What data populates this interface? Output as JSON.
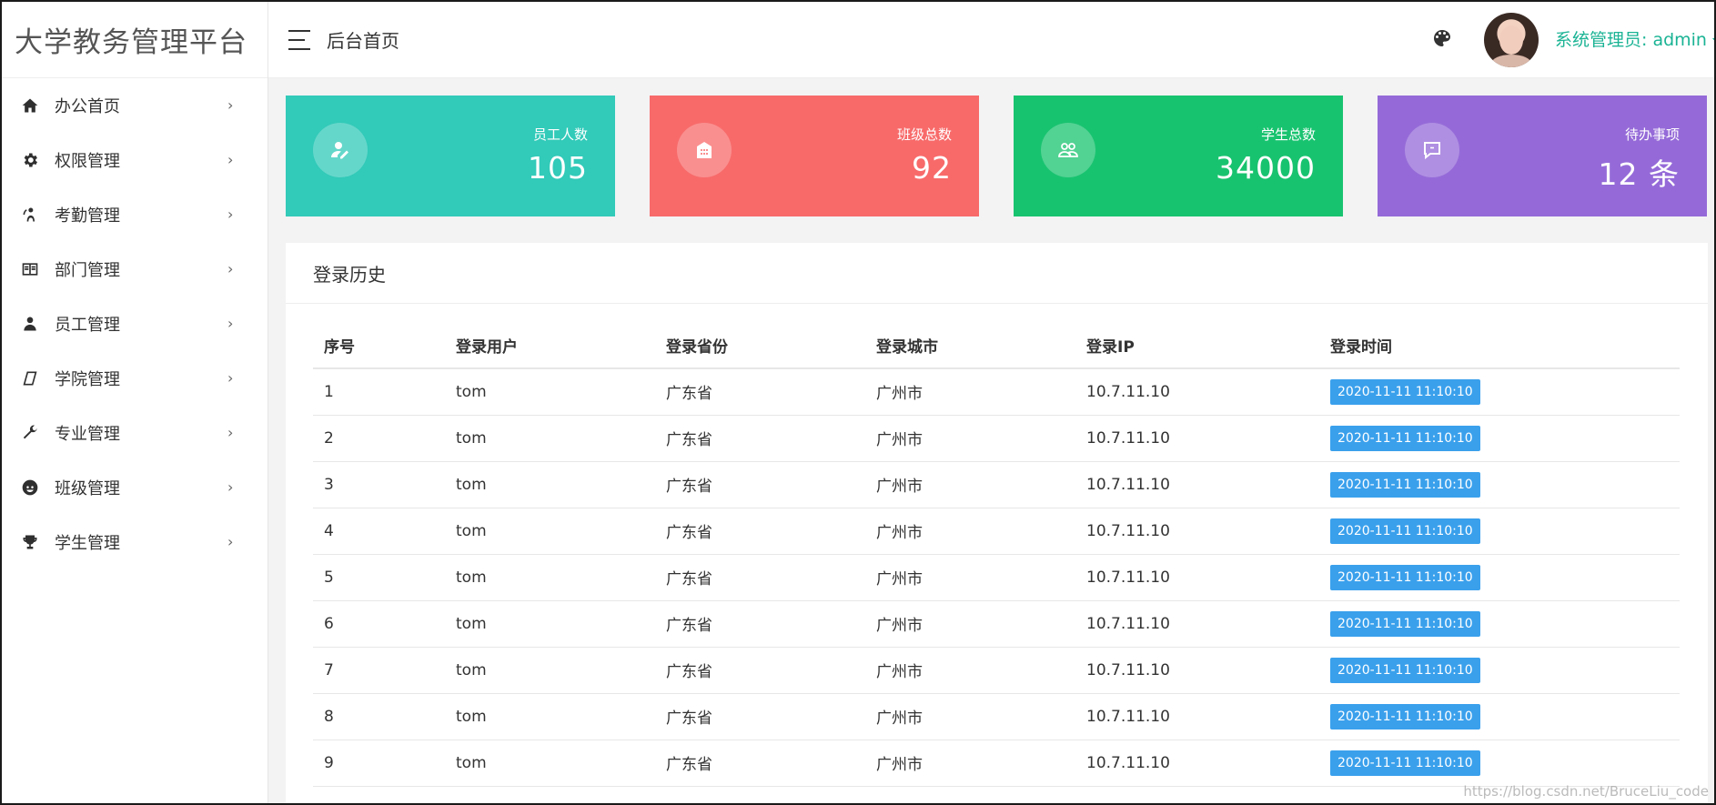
{
  "app": {
    "brand": "大学教务管理平台"
  },
  "header": {
    "title": "后台首页",
    "user_label": "系统管理员: admin"
  },
  "sidebar": {
    "items": [
      {
        "label": "办公首页",
        "icon": "home-icon"
      },
      {
        "label": "权限管理",
        "icon": "gear-icon"
      },
      {
        "label": "考勤管理",
        "icon": "attendance-icon"
      },
      {
        "label": "部门管理",
        "icon": "department-icon"
      },
      {
        "label": "员工管理",
        "icon": "user-icon"
      },
      {
        "label": "学院管理",
        "icon": "college-icon"
      },
      {
        "label": "专业管理",
        "icon": "wrench-icon"
      },
      {
        "label": "班级管理",
        "icon": "face-icon"
      },
      {
        "label": "学生管理",
        "icon": "trophy-icon"
      }
    ],
    "arrow": "›"
  },
  "cards": [
    {
      "label": "员工人数",
      "value": "105",
      "color": "#32cab9",
      "icon": "edit-user-icon"
    },
    {
      "label": "班级总数",
      "value": "92",
      "color": "#f86a6a",
      "icon": "building-icon"
    },
    {
      "label": "学生总数",
      "value": "34000",
      "color": "#18c36f",
      "icon": "group-icon"
    },
    {
      "label": "待办事项",
      "value": "12 条",
      "color": "#956ad8",
      "icon": "chat-icon"
    }
  ],
  "login_history": {
    "title": "登录历史",
    "columns": [
      "序号",
      "登录用户",
      "登录省份",
      "登录城市",
      "登录IP",
      "登录时间"
    ],
    "rows": [
      [
        "1",
        "tom",
        "广东省",
        "广州市",
        "10.7.11.10",
        "2020-11-11 11:10:10"
      ],
      [
        "2",
        "tom",
        "广东省",
        "广州市",
        "10.7.11.10",
        "2020-11-11 11:10:10"
      ],
      [
        "3",
        "tom",
        "广东省",
        "广州市",
        "10.7.11.10",
        "2020-11-11 11:10:10"
      ],
      [
        "4",
        "tom",
        "广东省",
        "广州市",
        "10.7.11.10",
        "2020-11-11 11:10:10"
      ],
      [
        "5",
        "tom",
        "广东省",
        "广州市",
        "10.7.11.10",
        "2020-11-11 11:10:10"
      ],
      [
        "6",
        "tom",
        "广东省",
        "广州市",
        "10.7.11.10",
        "2020-11-11 11:10:10"
      ],
      [
        "7",
        "tom",
        "广东省",
        "广州市",
        "10.7.11.10",
        "2020-11-11 11:10:10"
      ],
      [
        "8",
        "tom",
        "广东省",
        "广州市",
        "10.7.11.10",
        "2020-11-11 11:10:10"
      ],
      [
        "9",
        "tom",
        "广东省",
        "广州市",
        "10.7.11.10",
        "2020-11-11 11:10:10"
      ]
    ]
  },
  "watermark": "https://blog.csdn.net/BruceLiu_code"
}
